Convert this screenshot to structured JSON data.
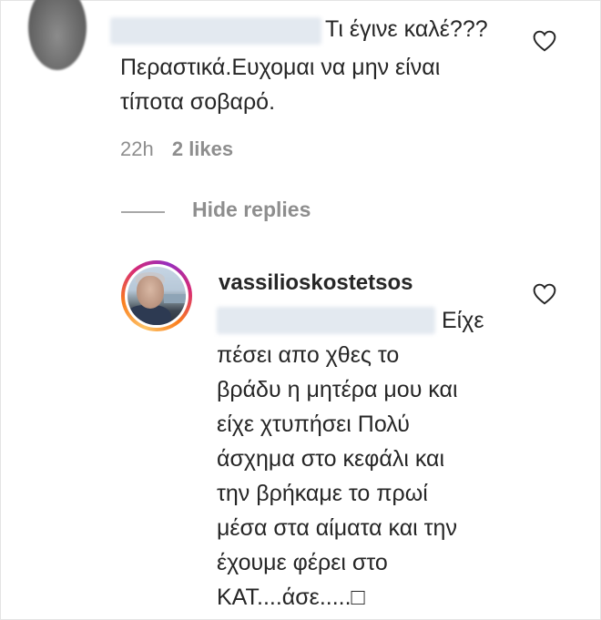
{
  "comment1": {
    "text_line1": "Τι έγινε καλέ???",
    "text_line2": "Περαστικά.Ευχομαι να μην είναι",
    "text_line3": "τίποτα σοβαρό.",
    "time": "22h",
    "likes": "2 likes"
  },
  "replies": {
    "hide_label": "Hide replies"
  },
  "reply1": {
    "username": "vassilioskostetsos",
    "lines": [
      "Είχε",
      "πέσει απο χθες το",
      "βράδυ η μητέρα μου και",
      "είχε χτυπήσει Πολύ",
      "άσχημα στο κεφάλι και",
      "την βρήκαμε το πρωί",
      "μέσα στα αίματα και την",
      "έχουμε φέρει στο",
      "ΚΑΤ....άσε.....□"
    ]
  },
  "icons": {
    "like": "heart-outline-icon"
  }
}
